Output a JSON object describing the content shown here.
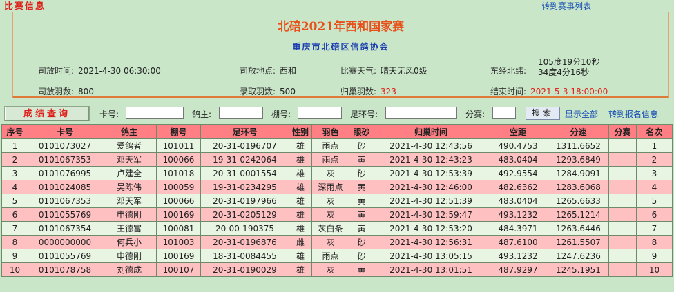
{
  "topbar": {
    "title": "比赛信息",
    "race_list_link": "转到赛事列表"
  },
  "race": {
    "title": "北碚2021年西和国家赛",
    "organizer": "重庆市北碚区信鸽协会",
    "release_time_label": "司放时间:",
    "release_time": "2021-4-30 06:30:00",
    "release_place_label": "司放地点:",
    "release_place": "西和",
    "weather_label": "比赛天气:",
    "weather": "晴天无风0级",
    "coord_label": "东经北纬:",
    "longitude": "105度19分10秒",
    "latitude": "34度4分16秒",
    "release_count_label": "司放羽数:",
    "release_count": "800",
    "accepted_count_label": "录取羽数:",
    "accepted_count": "500",
    "returned_count_label": "归巢羽数:",
    "returned_count": "323",
    "end_time_label": "结束时间:",
    "end_time": "2021-5-3 18:00:00",
    "accent_red": "#e0201b"
  },
  "search": {
    "query_button": "成绩查询",
    "card_label": "卡号:",
    "owner_label": "鸽主:",
    "loft_label": "棚号:",
    "ring_label": "足环号:",
    "sub_label": "分赛:",
    "search_button": "搜索",
    "show_all_link": "显示全部",
    "signup_link": "转到报名信息"
  },
  "table": {
    "headers": [
      "序号",
      "卡号",
      "鸽主",
      "棚号",
      "足环号",
      "性别",
      "羽色",
      "眼砂",
      "归巢时间",
      "空距",
      "分速",
      "分赛",
      "名次"
    ],
    "rows": [
      [
        "1",
        "0101073027",
        "爱鸽者",
        "101011",
        "20-31-0196707",
        "雄",
        "雨点",
        "砂",
        "2021-4-30 12:43:56",
        "490.4753",
        "1311.6652",
        "",
        "1"
      ],
      [
        "2",
        "0101067353",
        "邓天军",
        "100066",
        "19-31-0242064",
        "雄",
        "雨点",
        "黄",
        "2021-4-30 12:43:23",
        "483.0404",
        "1293.6849",
        "",
        "2"
      ],
      [
        "3",
        "0101076995",
        "卢建全",
        "101018",
        "20-31-0001554",
        "雄",
        "灰",
        "砂",
        "2021-4-30 12:53:39",
        "492.9554",
        "1284.9091",
        "",
        "3"
      ],
      [
        "4",
        "0101024085",
        "吴陈伟",
        "100059",
        "19-31-0234295",
        "雄",
        "深雨点",
        "黄",
        "2021-4-30 12:46:00",
        "482.6362",
        "1283.6068",
        "",
        "4"
      ],
      [
        "5",
        "0101067353",
        "邓天军",
        "100066",
        "20-31-0197966",
        "雄",
        "灰",
        "黄",
        "2021-4-30 12:51:39",
        "483.0404",
        "1265.6633",
        "",
        "5"
      ],
      [
        "6",
        "0101055769",
        "申德刚",
        "100169",
        "20-31-0205129",
        "雄",
        "灰",
        "黄",
        "2021-4-30 12:59:47",
        "493.1232",
        "1265.1214",
        "",
        "6"
      ],
      [
        "7",
        "0101067354",
        "王德富",
        "100081",
        "20-00-190375",
        "雄",
        "灰白条",
        "黄",
        "2021-4-30 12:53:20",
        "484.3971",
        "1263.6446",
        "",
        "7"
      ],
      [
        "8",
        "0000000000",
        "何兵小",
        "101003",
        "20-31-0196876",
        "雌",
        "灰",
        "砂",
        "2021-4-30 12:56:31",
        "487.6100",
        "1261.5507",
        "",
        "8"
      ],
      [
        "9",
        "0101055769",
        "申德刚",
        "100169",
        "18-31-0084455",
        "雄",
        "雨点",
        "砂",
        "2021-4-30 13:05:15",
        "493.1232",
        "1247.6236",
        "",
        "9"
      ],
      [
        "10",
        "0101078758",
        "刘德成",
        "100107",
        "20-31-0190029",
        "雄",
        "灰",
        "黄",
        "2021-4-30 13:01:51",
        "487.9297",
        "1245.1951",
        "",
        "10"
      ]
    ],
    "header_color": "#ff7f85",
    "odd_row_color": "#e9f5e3",
    "even_row_color": "#ffc0c2"
  }
}
